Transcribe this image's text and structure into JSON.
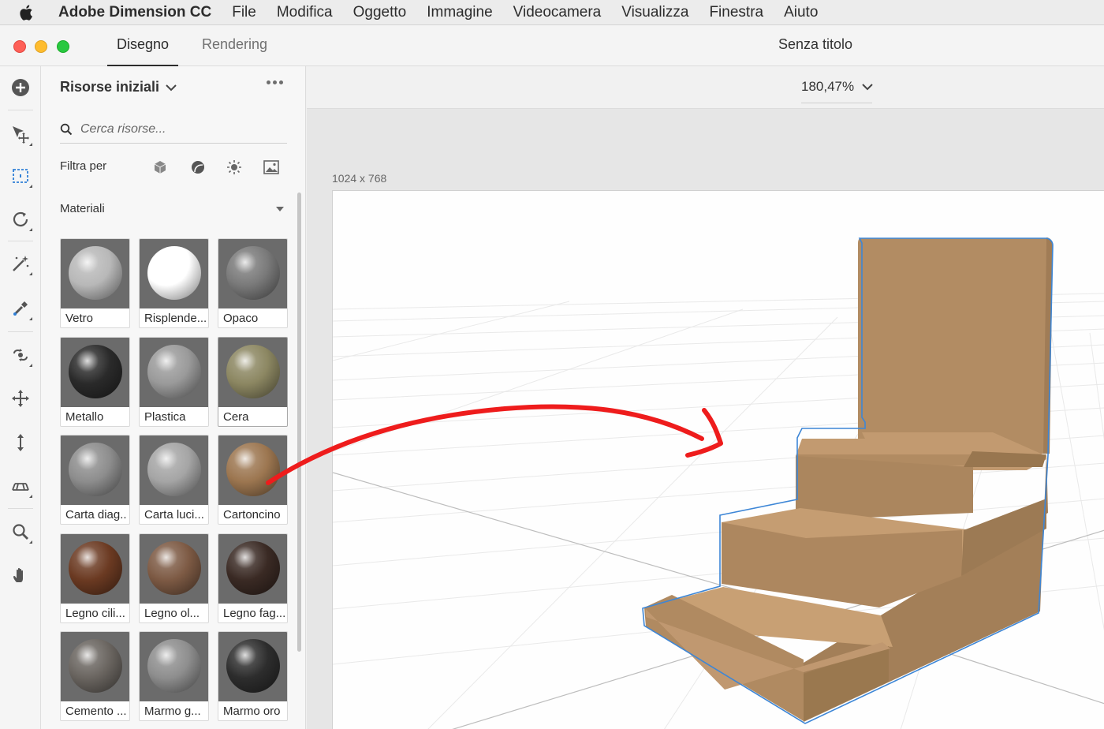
{
  "menubar": {
    "app_name": "Adobe Dimension CC",
    "items": [
      "File",
      "Modifica",
      "Oggetto",
      "Immagine",
      "Videocamera",
      "Visualizza",
      "Finestra",
      "Aiuto"
    ]
  },
  "titlebar": {
    "tabs": [
      {
        "label": "Disegno",
        "active": true
      },
      {
        "label": "Rendering",
        "active": false
      }
    ],
    "document_title": "Senza titolo"
  },
  "panel": {
    "title": "Risorse iniziali",
    "search_placeholder": "Cerca risorse...",
    "filter_label": "Filtra per",
    "filter_icons": [
      "model-icon",
      "material-icon",
      "light-icon",
      "image-icon"
    ],
    "section_label": "Materiali",
    "materials": [
      {
        "label": "Vetro",
        "color": "#b8b8b8"
      },
      {
        "label": "Risplende...",
        "color": "#ffffff"
      },
      {
        "label": "Opaco",
        "color": "#7a7a7a"
      },
      {
        "label": "Metallo",
        "color": "#2a2a2a"
      },
      {
        "label": "Plastica",
        "color": "#9a9a9a"
      },
      {
        "label": "Cera",
        "color": "#8c8762"
      },
      {
        "label": "Carta diag..",
        "color": "#8d8d8d"
      },
      {
        "label": "Carta luci...",
        "color": "#a5a5a5"
      },
      {
        "label": "Cartoncino",
        "color": "#9c7650"
      },
      {
        "label": "Legno cili...",
        "color": "#6b3a22"
      },
      {
        "label": "Legno ol...",
        "color": "#7d5a44"
      },
      {
        "label": "Legno fag...",
        "color": "#3a2a24"
      },
      {
        "label": "Cemento ...",
        "color": "#6a6560"
      },
      {
        "label": "Marmo g...",
        "color": "#8e8e8e"
      },
      {
        "label": "Marmo oro",
        "color": "#2d2d2d"
      }
    ]
  },
  "canvas": {
    "zoom": "180,47%",
    "dimensions": "1024 x 768"
  },
  "colors": {
    "annotation_arrow": "#ee1c1c",
    "selection_outline": "#3d86d6",
    "cardboard": "#b58f66"
  }
}
